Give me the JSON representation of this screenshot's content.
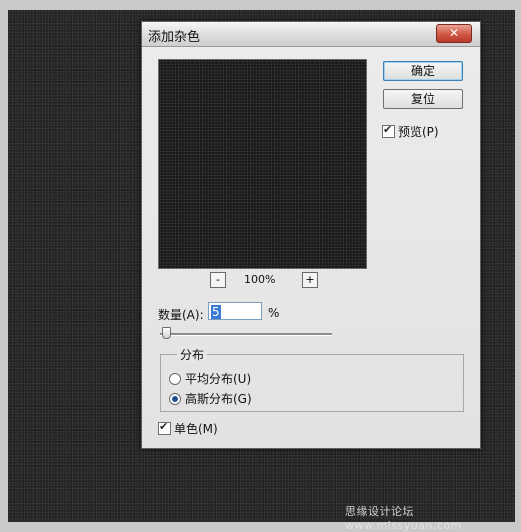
{
  "dialog": {
    "title": "添加杂色",
    "close_symbol": "✕"
  },
  "buttons": {
    "ok_label": "确定",
    "reset_label": "复位"
  },
  "preview_checkbox": {
    "label": "预览(P)",
    "checked": true
  },
  "zoom": {
    "minus": "-",
    "value": "100%",
    "plus": "+"
  },
  "amount": {
    "label": "数量(A):",
    "value": "5",
    "unit": "%"
  },
  "distribution": {
    "group_label": "分布",
    "uniform_label": "平均分布(U)",
    "gaussian_label": "高斯分布(G)",
    "selected": "gaussian"
  },
  "monochromatic": {
    "label": "单色(M)",
    "checked": true
  },
  "watermark": {
    "text": "思缘设计论坛 www.missyuan.com"
  }
}
